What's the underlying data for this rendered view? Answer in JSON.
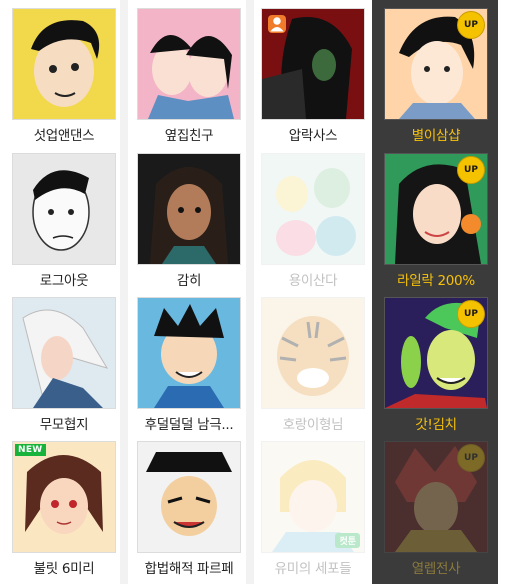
{
  "colors": {
    "up_badge": "#f5c200",
    "new_badge": "#17b33a",
    "highlight_title": "#f6c10a",
    "column_highlight_bg": "#3b3b3b"
  },
  "columns": [
    {
      "items": [
        {
          "title": "섯업앤댄스",
          "icon": "comic-thumbnail",
          "state": "normal"
        },
        {
          "title": "로그아웃",
          "icon": "comic-thumbnail",
          "state": "normal"
        },
        {
          "title": "무모협지",
          "icon": "comic-thumbnail",
          "state": "normal"
        },
        {
          "title": "불릿 6미리",
          "icon": "comic-thumbnail",
          "state": "normal",
          "badge": "NEW"
        }
      ]
    },
    {
      "items": [
        {
          "title": "옆집친구",
          "icon": "comic-thumbnail",
          "state": "normal"
        },
        {
          "title": "감히",
          "icon": "comic-thumbnail",
          "state": "normal"
        },
        {
          "title": "후덜덜덜 남극...",
          "icon": "comic-thumbnail",
          "state": "normal"
        },
        {
          "title": "합법해적 파르페",
          "icon": "comic-thumbnail",
          "state": "normal"
        }
      ]
    },
    {
      "items": [
        {
          "title": "압락사스",
          "icon": "comic-thumbnail",
          "state": "normal",
          "badge": "person"
        },
        {
          "title": "용이산다",
          "icon": "comic-thumbnail",
          "state": "dimmed"
        },
        {
          "title": "호랑이형님",
          "icon": "comic-thumbnail",
          "state": "dimmed"
        },
        {
          "title": "유미의 세포들",
          "icon": "comic-thumbnail",
          "state": "dimmed",
          "badge": "컷툰"
        }
      ]
    },
    {
      "items": [
        {
          "title": "별이삼샵",
          "icon": "comic-thumbnail",
          "state": "normal",
          "badge": "UP"
        },
        {
          "title": "라일락 200%",
          "icon": "comic-thumbnail",
          "state": "normal",
          "badge": "UP"
        },
        {
          "title": "갓!김치",
          "icon": "comic-thumbnail",
          "state": "normal",
          "badge": "UP"
        },
        {
          "title": "열렙전사",
          "icon": "comic-thumbnail",
          "state": "dimmed",
          "badge": "UP"
        }
      ]
    }
  ]
}
